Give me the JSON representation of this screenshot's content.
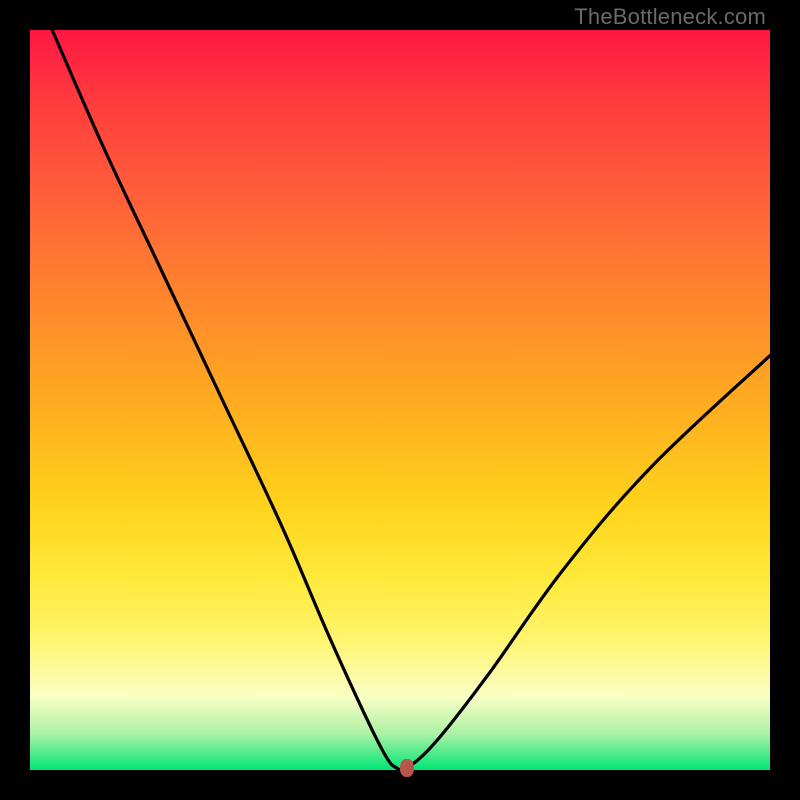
{
  "watermark": "TheBottleneck.com",
  "chart_data": {
    "type": "line",
    "title": "",
    "xlabel": "",
    "ylabel": "",
    "xlim": [
      0,
      100
    ],
    "ylim": [
      0,
      100
    ],
    "grid": false,
    "legend": false,
    "background_gradient": {
      "top": "#ff1744",
      "mid": "#ffd21c",
      "bottom": "#00e676"
    },
    "series": [
      {
        "name": "bottleneck-curve",
        "comment": "V-shaped bottleneck curve; y is bottleneck percentage (100 top, 0 bottom), x is normalized 0-100 across plot width.",
        "x": [
          3,
          10,
          18,
          26,
          34,
          40,
          45,
          48,
          49.5,
          51,
          55,
          62,
          72,
          84,
          100
        ],
        "values": [
          100,
          84,
          67,
          50,
          33,
          19,
          8,
          2,
          0.3,
          0.3,
          4,
          13,
          27,
          41,
          56
        ]
      }
    ],
    "marker": {
      "name": "optimal-point",
      "x": 51,
      "y": 0.3,
      "color": "#b7564d"
    }
  }
}
